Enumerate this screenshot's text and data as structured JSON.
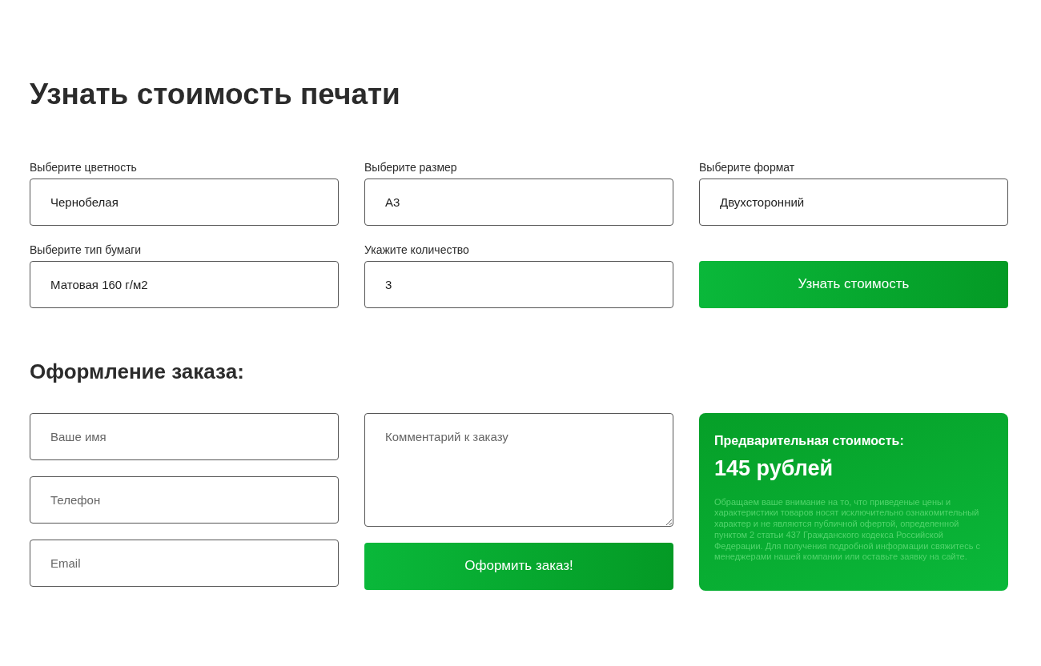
{
  "title": "Узнать стоимость печати",
  "calculator": {
    "fields": [
      {
        "label": "Выберите цветность",
        "value": "Чернобелая"
      },
      {
        "label": "Выберите размер",
        "value": "А3"
      },
      {
        "label": "Выберите формат",
        "value": "Двухсторонний"
      },
      {
        "label": "Выберите тип бумаги",
        "value": "Матовая 160 г/м2"
      },
      {
        "label": "Укажите количество",
        "value": "3"
      }
    ],
    "button": "Узнать стоимость"
  },
  "order": {
    "heading": "Оформление заказа:",
    "contact_fields": [
      {
        "placeholder": "Ваше имя"
      },
      {
        "placeholder": "Телефон"
      },
      {
        "placeholder": "Email"
      }
    ],
    "comment": {
      "placeholder": "Комментарий к заказу"
    },
    "button": "Оформить заказ!",
    "price_card": {
      "label": "Предварительная стоимость:",
      "price": "145 рублей",
      "disclaimer": "Обращаем ваше внимание на то, что приведеные цены и характеристики товаров носят исключительно ознакомительный характер и не являются публичной офертой, определенной пунктом 2 статьи 437 Гражданского кодекса Российской Федерации. Для получения подробной информации свяжитесь с менеджерами нашей компании или оставьте заявку на сайте."
    }
  }
}
